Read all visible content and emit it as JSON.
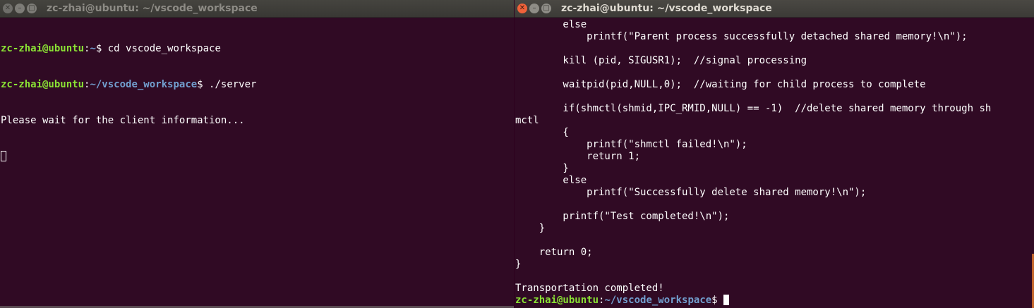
{
  "left_window": {
    "title": "zc-zhai@ubuntu: ~/vscode_workspace",
    "lines": [
      {
        "user": "zc-zhai@ubuntu",
        "sep": ":",
        "path": "~",
        "suffix": "$ cd vscode_workspace"
      },
      {
        "user": "zc-zhai@ubuntu",
        "sep": ":",
        "path": "~/vscode_workspace",
        "suffix": "$ ./server"
      },
      {
        "text": "Please wait for the client information..."
      }
    ]
  },
  "right_window": {
    "title": "zc-zhai@ubuntu: ~/vscode_workspace",
    "code_lines": [
      "        else",
      "            printf(\"Parent process successfully detached shared memory!\\n\");",
      "",
      "        kill (pid, SIGUSR1);  //signal processing",
      "",
      "        waitpid(pid,NULL,0);  //waiting for child process to complete",
      "",
      "        if(shmctl(shmid,IPC_RMID,NULL) == -1)  //delete shared memory through sh",
      "mctl",
      "        {",
      "            printf(\"shmctl failed!\\n\");",
      "            return 1;",
      "        }",
      "        else",
      "            printf(\"Successfully delete shared memory!\\n\");",
      "",
      "        printf(\"Test completed!\\n\");",
      "    }",
      "",
      "    return 0;",
      "}",
      "",
      "Transportation completed!"
    ],
    "prompt": {
      "user": "zc-zhai@ubuntu",
      "sep": ":",
      "path": "~/vscode_workspace",
      "suffix": "$ "
    }
  },
  "colors": {
    "terminal_bg": "#300a24",
    "user": "#8ae234",
    "path": "#729fcf",
    "close_active": "#f0623a"
  },
  "icons": [
    "close-icon",
    "minimize-icon",
    "maximize-icon"
  ]
}
